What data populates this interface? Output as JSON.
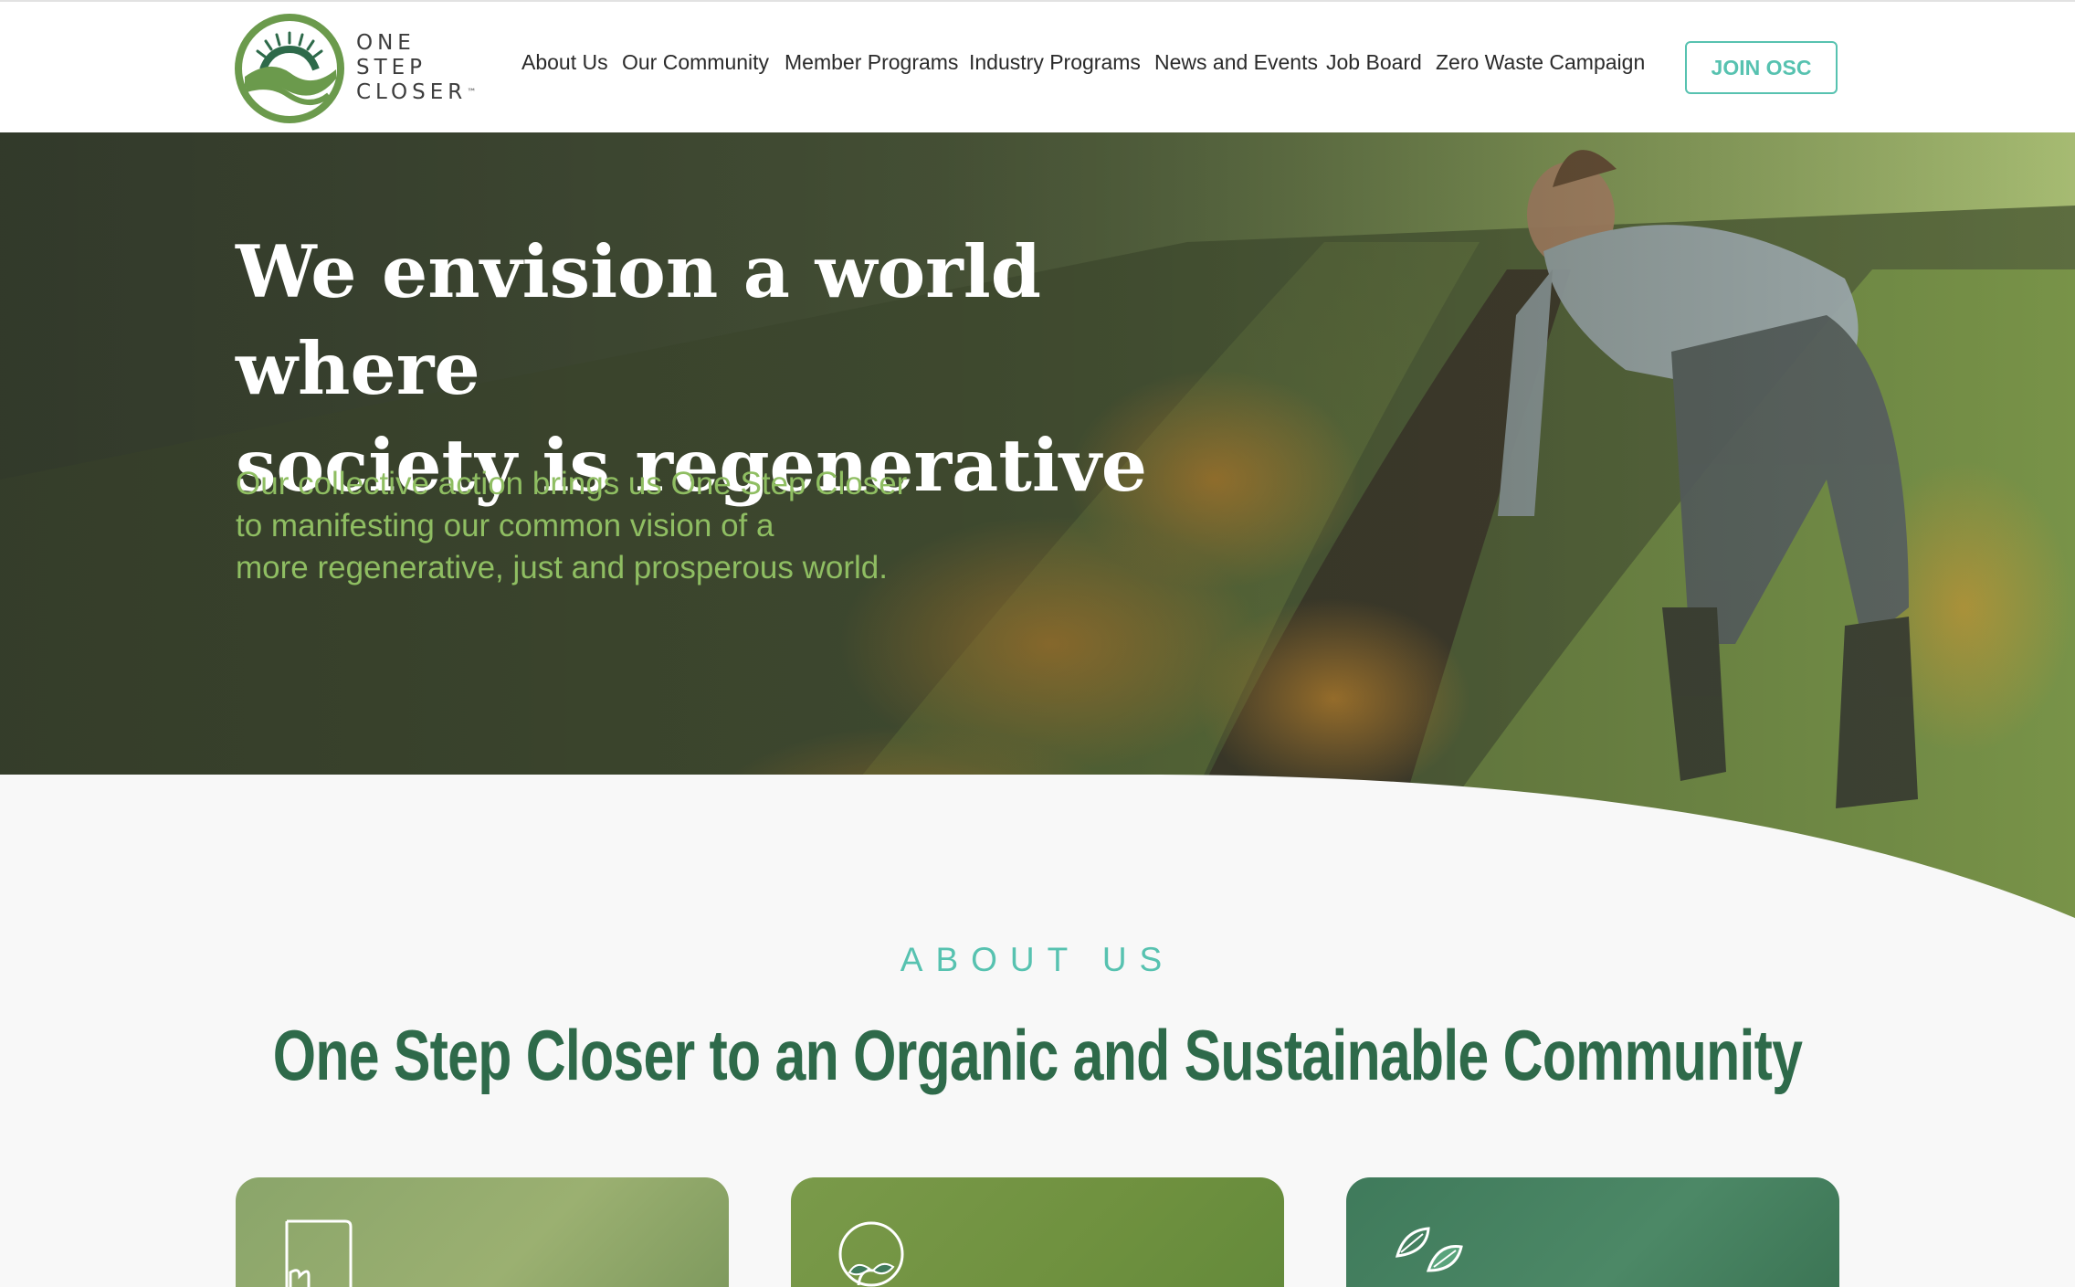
{
  "brand": {
    "logo_lines": [
      "ONE",
      "STEP",
      "CLOSER"
    ],
    "trademark": "™",
    "colors": {
      "teal": "#57c2b0",
      "green": "#2e6a4a",
      "olive": "#8fbe62",
      "logo_green": "#6b9a4c"
    }
  },
  "nav": {
    "items": [
      {
        "label": "About Us"
      },
      {
        "label": "Our Community"
      },
      {
        "label": "Member Programs"
      },
      {
        "label": "Industry Programs"
      },
      {
        "label": "News and Events"
      },
      {
        "label": "Job Board"
      },
      {
        "label": "Zero Waste Campaign"
      }
    ],
    "cta_label": "JOIN OSC"
  },
  "hero": {
    "title_line1": "We envision a world where",
    "title_line2": "society is regenerative",
    "subtitle_line1": "Our collective action brings us One Step Closer",
    "subtitle_line2": "to manifesting our common vision of a",
    "subtitle_line3": "more regenerative, just and prosperous world."
  },
  "about": {
    "kicker": "ABOUT US",
    "heading": "One Step Closer to an Organic and Sustainable Community"
  },
  "cards": [
    {
      "icon": "puzzle-icon"
    },
    {
      "icon": "sprout-circle-icon"
    },
    {
      "icon": "leaves-icon"
    }
  ]
}
